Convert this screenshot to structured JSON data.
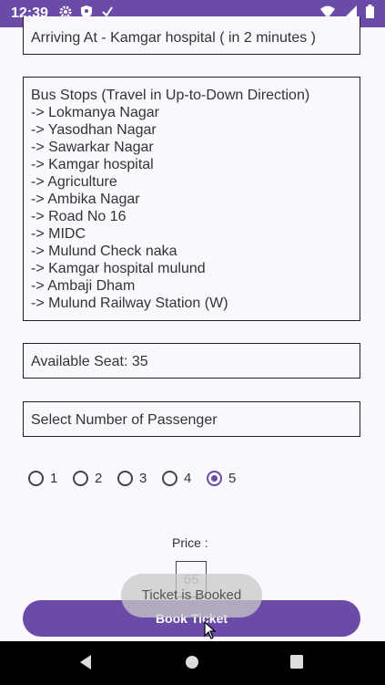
{
  "status_bar": {
    "time": "12:39",
    "icons_left": [
      "gear-icon",
      "shield-icon",
      "check-icon"
    ],
    "icons_right": [
      "wifi-icon",
      "signal-icon",
      "battery-icon"
    ]
  },
  "arriving": {
    "text": "Arriving At - Kamgar hospital ( in 2 minutes )"
  },
  "stops": {
    "header": "Bus Stops (Travel in Up-to-Down Direction)",
    "items": [
      "-> Lokmanya Nagar",
      "-> Yasodhan Nagar",
      "-> Sawarkar Nagar",
      "-> Kamgar hospital",
      "-> Agriculture",
      "-> Ambika Nagar",
      "-> Road No 16",
      "-> MIDC",
      "-> Mulund Check naka",
      "-> Kamgar hospital mulund",
      "-> Ambaji Dham",
      "-> Mulund Railway Station (W)"
    ]
  },
  "seat": {
    "text": "Available Seat: 35"
  },
  "passenger": {
    "placeholder": "Select Number of Passenger"
  },
  "radios": {
    "options": [
      "1",
      "2",
      "3",
      "4",
      "5"
    ],
    "selected": "5"
  },
  "price": {
    "label": "Price :",
    "value": "65"
  },
  "book_button": {
    "label": "Book Ticket"
  },
  "toast": {
    "text": "Ticket is Booked"
  },
  "colors": {
    "primary": "#6b4ba8",
    "background": "#fbf8fd"
  }
}
